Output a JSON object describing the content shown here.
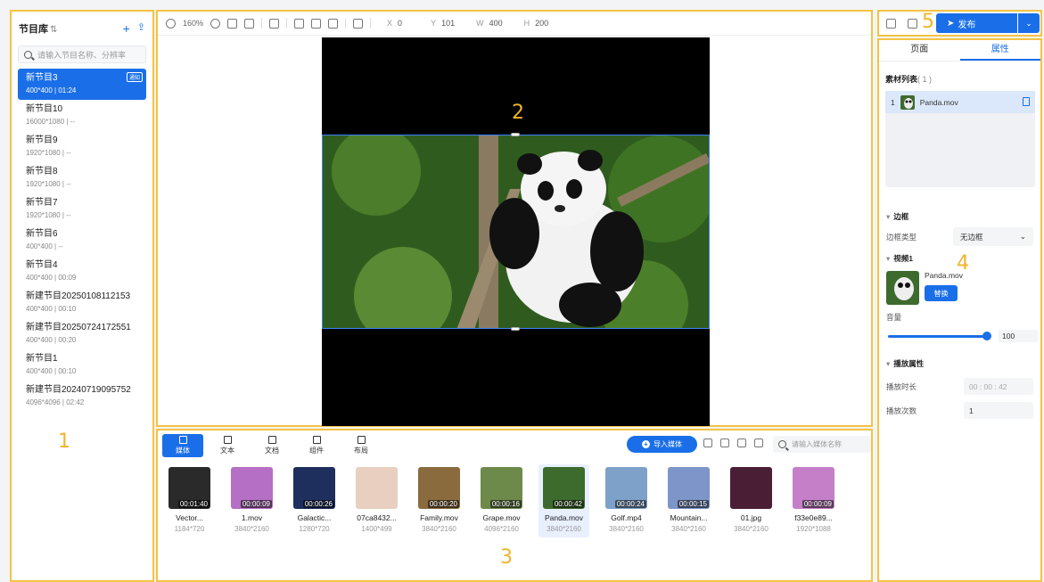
{
  "library": {
    "title": "节目库",
    "filter_glyph": "⇅",
    "add_glyph": "+",
    "upload_glyph": "⇪",
    "search_placeholder": "请输入节目名称、分辨率",
    "programs": [
      {
        "name": "新节目3",
        "meta": "400*400 | 01:24",
        "selected": true,
        "tag": "通知"
      },
      {
        "name": "新节目10",
        "meta": "16000*1080 | --"
      },
      {
        "name": "新节目9",
        "meta": "1920*1080 | --"
      },
      {
        "name": "新节目8",
        "meta": "1920*1080 | --"
      },
      {
        "name": "新节目7",
        "meta": "1920*1080 | --"
      },
      {
        "name": "新节目6",
        "meta": "400*400 | --"
      },
      {
        "name": "新节目4",
        "meta": "400*400 | 00:09"
      },
      {
        "name": "新建节目20250108112153",
        "meta": "400*400 | 00:10"
      },
      {
        "name": "新建节目20250724172551",
        "meta": "400*400 | 00:20"
      },
      {
        "name": "新节目1",
        "meta": "400*400 | 00:10"
      },
      {
        "name": "新建节目20240719095752",
        "meta": "4096*4096 | 02:42"
      }
    ]
  },
  "toolbar": {
    "zoom": "160%",
    "x_label": "X",
    "x": "0",
    "y_label": "Y",
    "y": "101",
    "w_label": "W",
    "w": "400",
    "h_label": "H",
    "h": "200"
  },
  "media": {
    "tabs": [
      {
        "label": "媒体",
        "icon": "media-icon"
      },
      {
        "label": "文本",
        "icon": "text-icon"
      },
      {
        "label": "文档",
        "icon": "document-icon"
      },
      {
        "label": "组件",
        "icon": "widget-icon"
      },
      {
        "label": "布局",
        "icon": "layout-icon"
      }
    ],
    "import_label": "导入媒体",
    "search_placeholder": "请输入媒体名称",
    "items": [
      {
        "name": "Vector...",
        "res": "1184*720",
        "dur": "00:01:40",
        "color": "#2a2a2a"
      },
      {
        "name": "1.mov",
        "res": "3840*2160",
        "dur": "00:00:09",
        "color": "#b56fc4"
      },
      {
        "name": "Galactic...",
        "res": "1280*720",
        "dur": "00:00:26",
        "color": "#1e2f5e"
      },
      {
        "name": "07ca8432...",
        "res": "1400*499",
        "dur": "",
        "color": "#e8cfc0"
      },
      {
        "name": "Family.mov",
        "res": "3840*2160",
        "dur": "00:00:20",
        "color": "#8a6b3e"
      },
      {
        "name": "Grape.mov",
        "res": "4096*2160",
        "dur": "00:00:16",
        "color": "#6e8a4a"
      },
      {
        "name": "Panda.mov",
        "res": "3840*2160",
        "dur": "00:00:42",
        "color": "#3d6b2e",
        "selected": true
      },
      {
        "name": "Golf.mp4",
        "res": "3840*2160",
        "dur": "00:00:24",
        "color": "#7ea1c9"
      },
      {
        "name": "Mountain...",
        "res": "3840*2160",
        "dur": "00:00:15",
        "color": "#7d95c8"
      },
      {
        "name": "01.jpg",
        "res": "3840*2160",
        "dur": "",
        "color": "#4a1f36"
      },
      {
        "name": "f33e0e89...",
        "res": "1920*1088",
        "dur": "00:00:09",
        "color": "#c57fc9"
      }
    ]
  },
  "publish": {
    "label": "发布"
  },
  "props": {
    "tab_page": "页面",
    "tab_props": "属性",
    "material_title": "素材列表",
    "material_count": "( 1 )",
    "material_index": "1",
    "material_name": "Panda.mov",
    "border_group": "边框",
    "border_type_label": "边框类型",
    "border_type_value": "无边框",
    "video_group": "视频1",
    "video_name": "Panda.mov",
    "replace_label": "替换",
    "volume_label": "音量",
    "volume_value": "100",
    "volume_level": 1.0,
    "playback_group": "播放属性",
    "duration_label": "播放时长",
    "duration_value": "00 : 00 : 42",
    "count_label": "播放次数",
    "count_value": "1"
  },
  "zone_labels": {
    "z1": "1",
    "z2": "2",
    "z3": "3",
    "z4": "4",
    "z5": "5"
  }
}
